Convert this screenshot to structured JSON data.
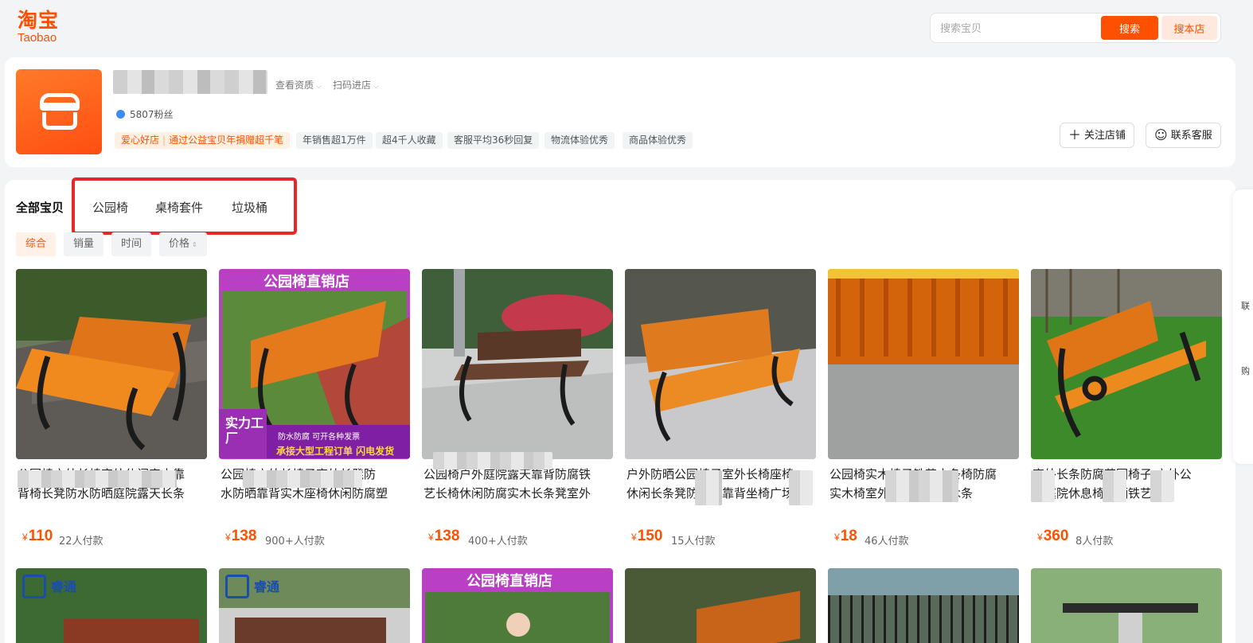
{
  "header": {
    "logo_cn": "淘宝",
    "logo_en": "Taobao",
    "search_placeholder": "搜索宝贝",
    "search_button": "搜索",
    "search_store_button": "搜本店"
  },
  "shop": {
    "links": [
      "查看资质",
      "扫码进店"
    ],
    "fans": "5807粉丝",
    "love_tag": "爱心好店",
    "love_text": "通过公益宝贝年捐赠超千笔",
    "tags": [
      "年销售超1万件",
      "超4千人收藏",
      "客服平均36秒回复",
      "物流体验优秀",
      "商品体验优秀"
    ],
    "follow_button": "关注店铺",
    "contact_button": "联系客服"
  },
  "categories": {
    "all": "全部宝贝",
    "items": [
      "公园椅",
      "桌椅套件",
      "垃圾桶"
    ]
  },
  "sort": [
    "综合",
    "销量",
    "时间",
    "价格"
  ],
  "promo": {
    "banner": "公园椅直销店",
    "badge": "实力工厂",
    "line1": "防水防腐  可开各种发票",
    "line2": "承接大型工程订单 闪电发货"
  },
  "products": [
    {
      "title_l1": "公园椅户外长椅室外休闲实木靠",
      "title_l2": "背椅长凳防水防晒庭院露天长条",
      "price": "110",
      "sold": "22人付款"
    },
    {
      "title_l1": "公园椅户外长椅子室外长凳防",
      "title_l2": "水防晒靠背实木座椅休闲防腐塑",
      "price": "138",
      "sold": "900+人付款"
    },
    {
      "title_l1": "公园椅户外庭院露天靠背防腐铁",
      "title_l2": "艺长椅休闲防腐实木长条凳室外",
      "price": "138",
      "sold": "400+人付款"
    },
    {
      "title_l1": "户外防晒公园椅子室外长椅座椅",
      "title_l2": "休闲长条凳防腐木靠背坐椅广场",
      "price": "150",
      "sold": "15人付款"
    },
    {
      "title_l1": "公园椅实木椅子铁艺木条椅防腐",
      "title_l2": "实木椅室外靠背椅配件木条",
      "price": "18",
      "sold": "46人付款"
    },
    {
      "title_l1": "室外长条防腐花园椅子 户外公",
      "title_l2": "园庭院休息椅防晒铁艺实",
      "price": "360",
      "sold": "8人付款"
    }
  ],
  "second_row": {
    "brand": "睿通",
    "banner": "公园椅直销店"
  },
  "rail": [
    "联",
    "购"
  ],
  "currency": "¥",
  "colors": {
    "accent": "#ff5000",
    "highlight": "#e8262a"
  }
}
